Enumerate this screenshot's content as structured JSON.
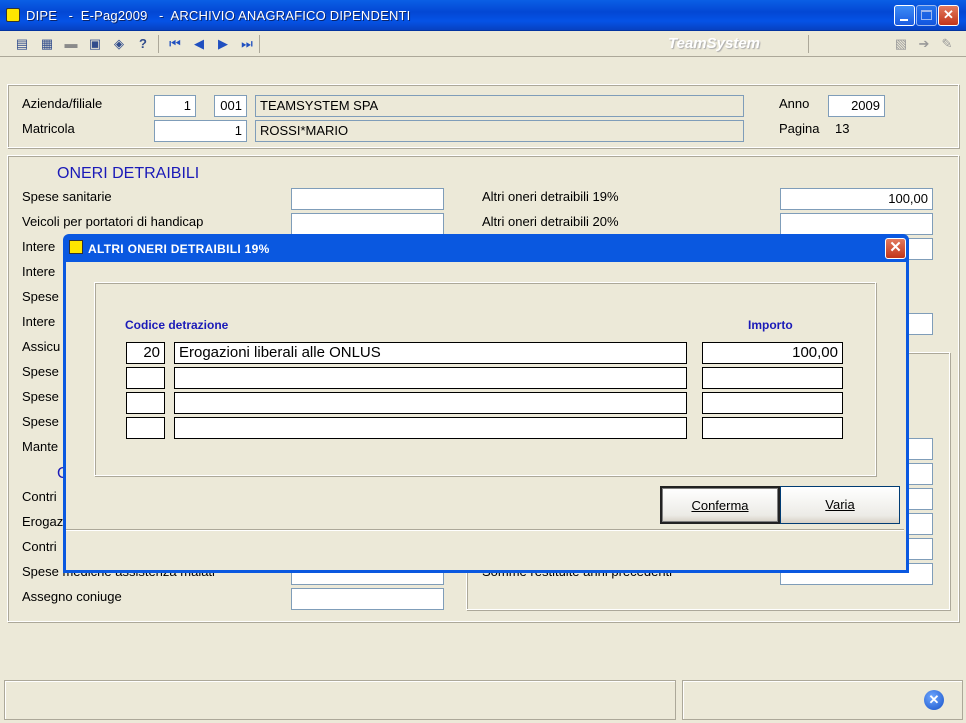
{
  "window": {
    "title": "DIPE   -  E-Pag2009   -  ARCHIVIO ANAGRAFICO DIPENDENTI",
    "brand": "TeamSystem"
  },
  "toolbar": {
    "icons": [
      "save-icon",
      "print-icon",
      "folder-icon",
      "settings-icon",
      "web-icon",
      "help-icon",
      "first-record-icon",
      "prev-record-icon",
      "next-record-icon",
      "last-record-icon"
    ]
  },
  "header": {
    "azienda_label": "Azienda/filiale",
    "azienda_code": "1",
    "filiale_code": "001",
    "azienda_name": "TEAMSYSTEM SPA",
    "matricola_label": "Matricola",
    "matricola_value": "1",
    "employee_name": "ROSSI*MARIO",
    "anno_label": "Anno",
    "anno_value": "2009",
    "pagina_label": "Pagina",
    "pagina_value": "13"
  },
  "main": {
    "section_title": "ONERI DETRAIBILI",
    "section2_title_partial": "O",
    "left_labels": [
      "Spese sanitarie",
      "Veicoli per portatori di handicap",
      "Intere",
      "Intere",
      "Spese",
      "Intere",
      "Assicu",
      "Spese",
      "Spese",
      "Spese",
      "Mante"
    ],
    "lower_left_labels": [
      "Contri",
      "Erogaz",
      "Contri",
      "Spese mediche assistenza malati",
      "Assegno coniuge"
    ],
    "right_labels": [
      "Altri oneri detraibili 19%",
      "Altri oneri detraibili 20%",
      "Somme restituite anni precedenti"
    ],
    "altri_19_value": "100,00"
  },
  "dialog": {
    "title": "ALTRI ONERI DETRAIBILI 19%",
    "col_codice": "Codice detrazione",
    "col_importo": "Importo",
    "rows": [
      {
        "code": "20",
        "desc": "Erogazioni liberali alle ONLUS",
        "amount": "100,00"
      },
      {
        "code": "",
        "desc": "",
        "amount": ""
      },
      {
        "code": "",
        "desc": "",
        "amount": ""
      },
      {
        "code": "",
        "desc": "",
        "amount": ""
      }
    ],
    "confirm_label": "Conferma",
    "varia_label": "Varia"
  },
  "colors": {
    "title_blue": "#0A58E0",
    "label_blue": "#1A1AB8",
    "face": "#ECE9D8"
  }
}
